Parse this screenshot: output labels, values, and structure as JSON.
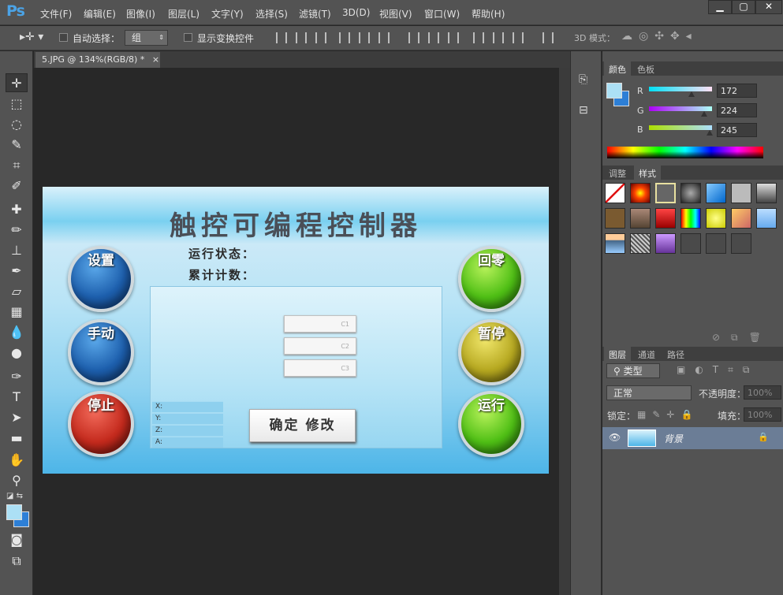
{
  "app": {
    "logo": "Ps"
  },
  "menu": [
    "文件(F)",
    "编辑(E)",
    "图像(I)",
    "图层(L)",
    "文字(Y)",
    "选择(S)",
    "滤镜(T)",
    "3D(D)",
    "视图(V)",
    "窗口(W)",
    "帮助(H)"
  ],
  "window_buttons": {
    "minimize": "▁",
    "maximize": "▢",
    "close": "✕"
  },
  "options": {
    "auto_select_label": "自动选择：",
    "auto_select_value": "组",
    "show_transform_label": "显示变换控件",
    "mode_3d_label": "3D 模式："
  },
  "document": {
    "tab_label": "5.JPG @ 134%(RGB/8) *",
    "tab_close": "×"
  },
  "image": {
    "title": "触控可编程控制器",
    "status_label": "运行状态：",
    "count_label": "累计计数：",
    "fields": [
      "C1",
      "C2",
      "C3"
    ],
    "axes": [
      "X:",
      "Y:",
      "Z:",
      "A:"
    ],
    "confirm_button": "确定 修改",
    "left_buttons": [
      "设置",
      "手动",
      "停止"
    ],
    "right_buttons": [
      "回零",
      "暂停",
      "运行"
    ]
  },
  "color_panel": {
    "tabs": [
      "颜色",
      "色板"
    ],
    "r_label": "R",
    "g_label": "G",
    "b_label": "B",
    "r": "172",
    "g": "224",
    "b": "245",
    "swatch_color": "#ace0f5"
  },
  "style_panel": {
    "tabs": [
      "调整",
      "样式"
    ]
  },
  "layers_panel": {
    "tabs": [
      "图层",
      "通道",
      "路径"
    ],
    "filter_label": "类型",
    "blend_mode": "正常",
    "opacity_label": "不透明度：",
    "opacity": "100%",
    "lock_label": "锁定：",
    "fill_label": "填充：",
    "fill": "100%",
    "layer_name": "背景"
  }
}
